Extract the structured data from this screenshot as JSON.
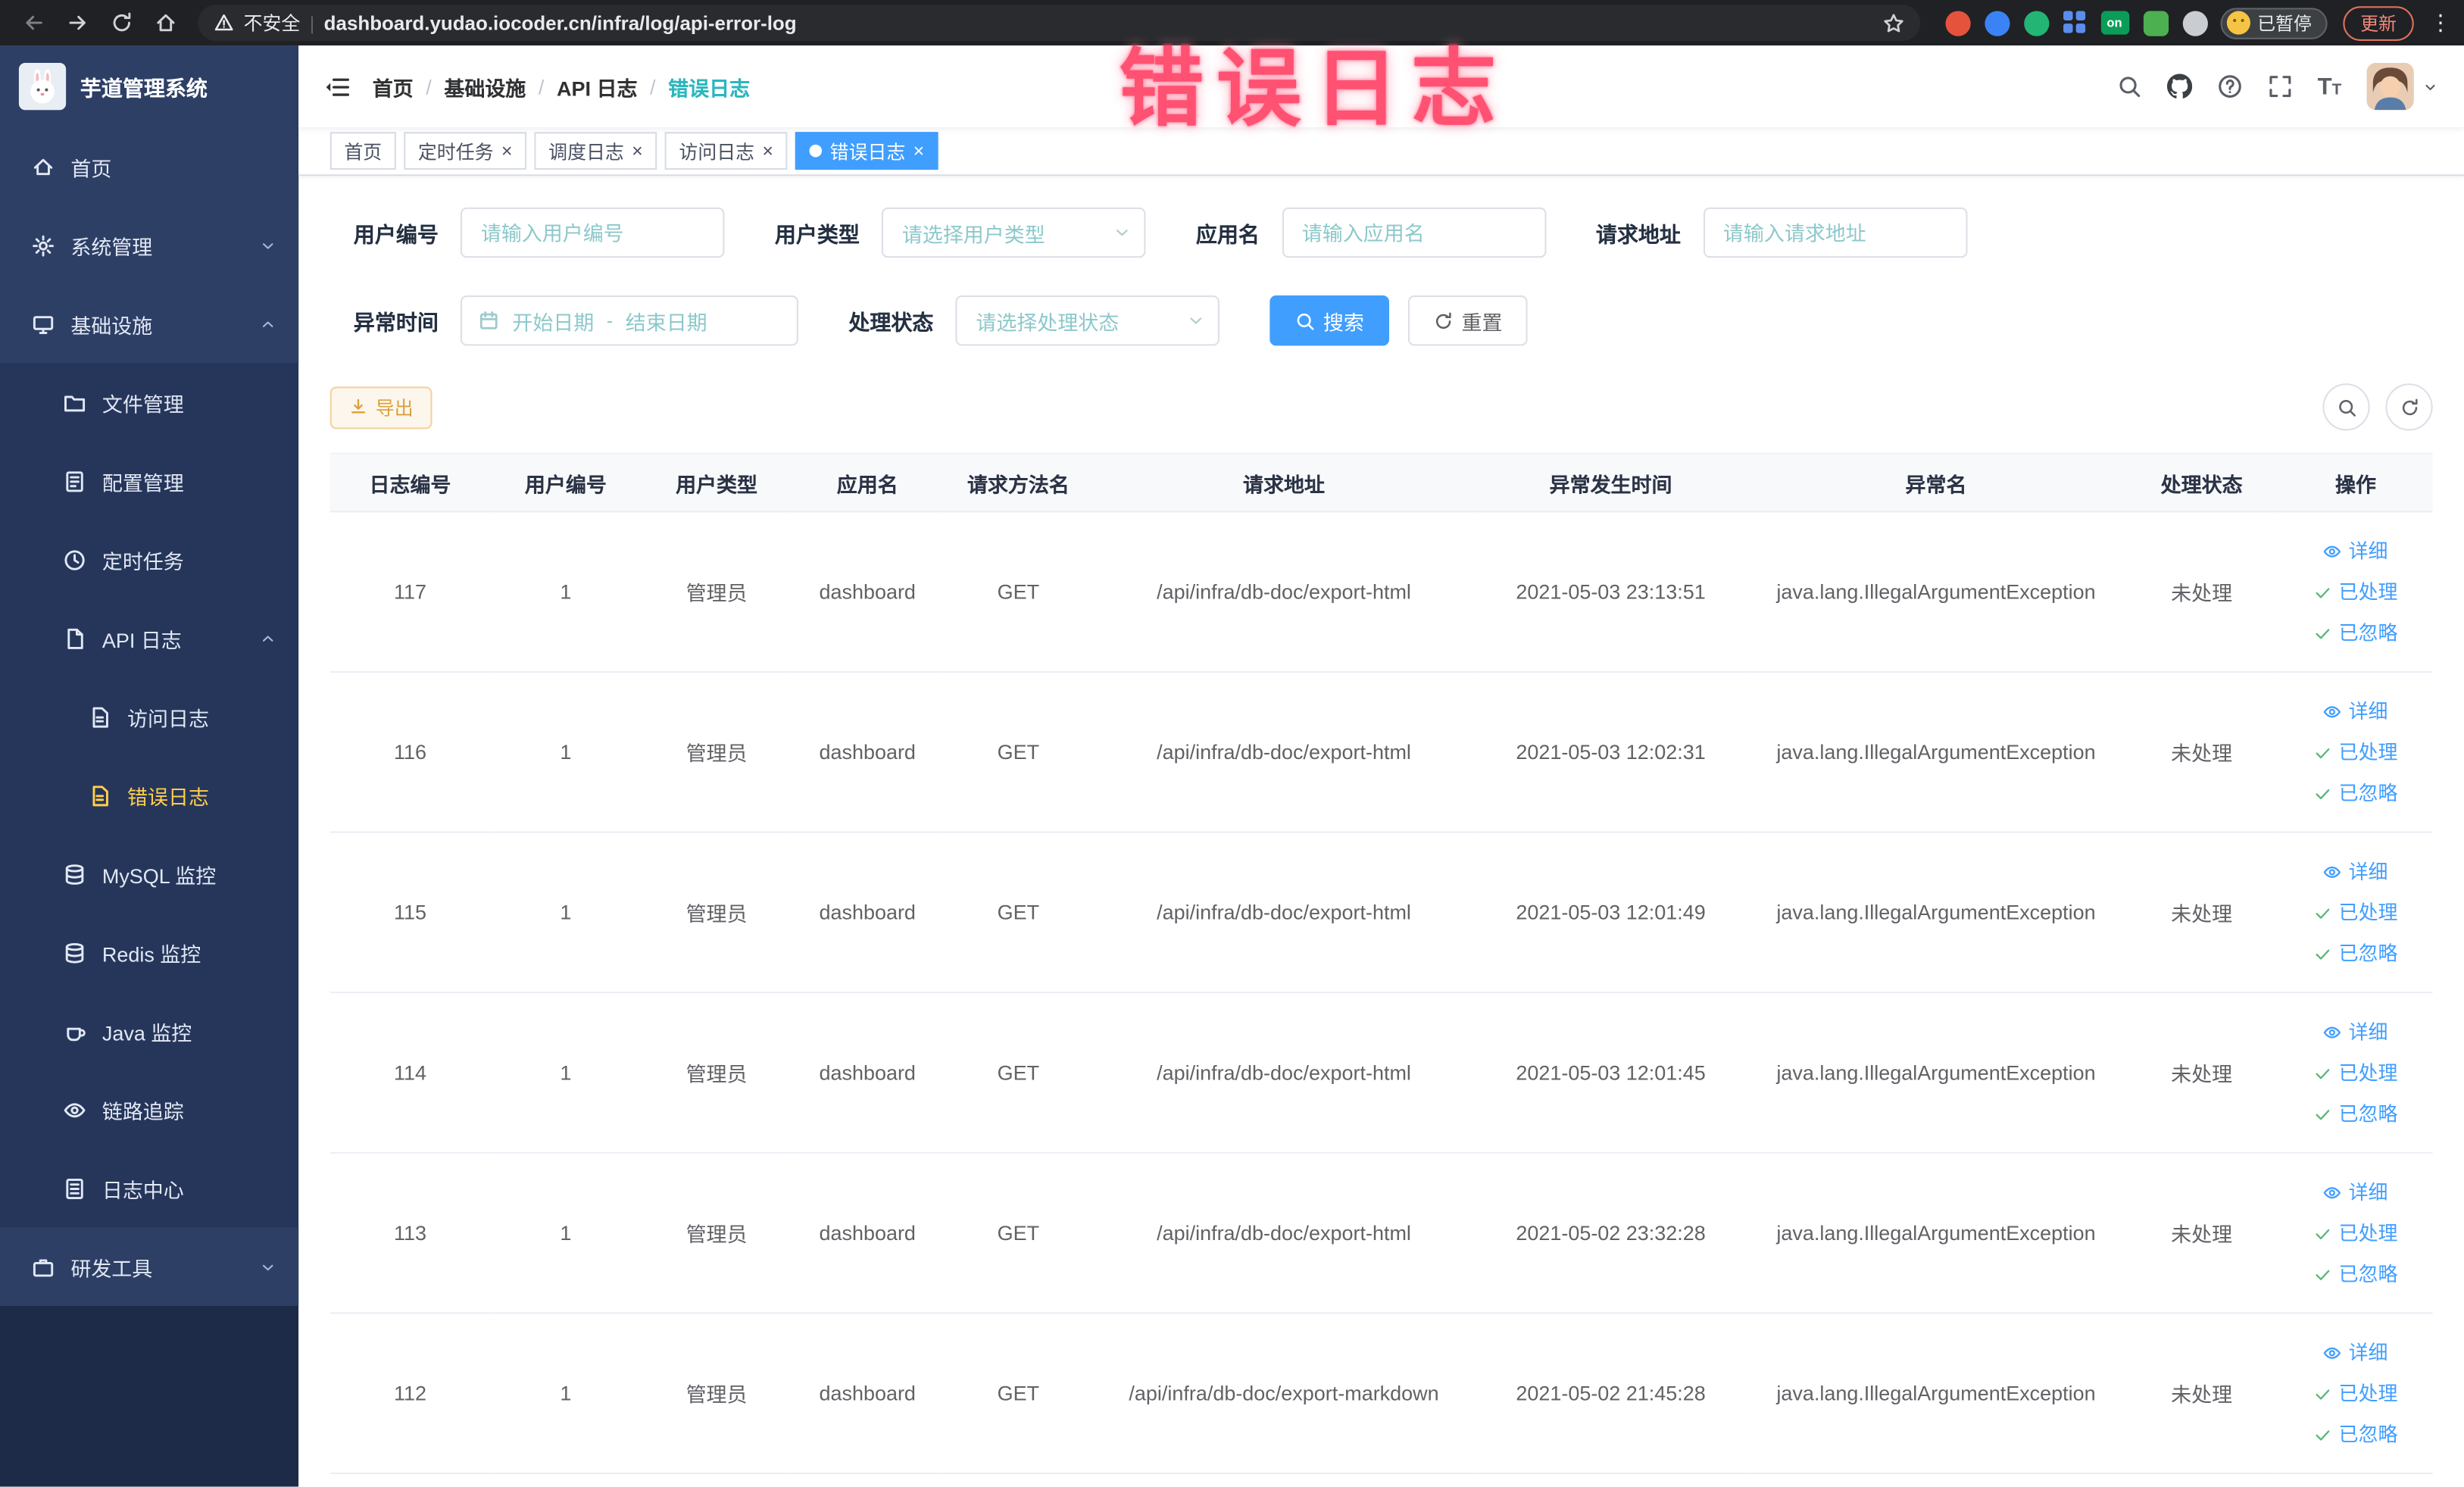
{
  "watermark": "错误日志",
  "browser": {
    "security_label": "不安全",
    "url": "dashboard.yudao.iocoder.cn/infra/log/api-error-log",
    "on_badge": "on",
    "paused_label": "已暂停",
    "update_label": "更新"
  },
  "icons": {
    "close": "×",
    "kebab": "⋮",
    "help": "?",
    "font_big": "T",
    "font_small": "T",
    "omni_separator": "|"
  },
  "sidebar": {
    "logo_title": "芋道管理系统",
    "items": [
      {
        "label": "首页"
      },
      {
        "label": "系统管理"
      },
      {
        "label": "基础设施"
      },
      {
        "label": "文件管理"
      },
      {
        "label": "配置管理"
      },
      {
        "label": "定时任务"
      },
      {
        "label": "API 日志"
      },
      {
        "label": "访问日志"
      },
      {
        "label": "错误日志"
      },
      {
        "label": "MySQL 监控"
      },
      {
        "label": "Redis 监控"
      },
      {
        "label": "Java 监控"
      },
      {
        "label": "链路追踪"
      },
      {
        "label": "日志中心"
      },
      {
        "label": "研发工具"
      }
    ]
  },
  "breadcrumb": [
    "首页",
    "基础设施",
    "API 日志",
    "错误日志"
  ],
  "tabs": [
    {
      "label": "首页"
    },
    {
      "label": "定时任务"
    },
    {
      "label": "调度日志"
    },
    {
      "label": "访问日志"
    },
    {
      "label": "错误日志"
    }
  ],
  "filters": {
    "user_id": {
      "label": "用户编号",
      "placeholder": "请输入用户编号"
    },
    "user_type": {
      "label": "用户类型",
      "placeholder": "请选择用户类型"
    },
    "app_name": {
      "label": "应用名",
      "placeholder": "请输入应用名"
    },
    "request_url": {
      "label": "请求地址",
      "placeholder": "请输入请求地址"
    },
    "exception_time": {
      "label": "异常时间",
      "start_placeholder": "开始日期",
      "separator": "-",
      "end_placeholder": "结束日期"
    },
    "process_status": {
      "label": "处理状态",
      "placeholder": "请选择处理状态"
    },
    "search_label": "搜索",
    "reset_label": "重置"
  },
  "toolbar": {
    "export_label": "导出"
  },
  "table": {
    "headers": [
      "日志编号",
      "用户编号",
      "用户类型",
      "应用名",
      "请求方法名",
      "请求地址",
      "异常发生时间",
      "异常名",
      "处理状态",
      "操作"
    ],
    "actions": [
      "详细",
      "已处理",
      "已忽略"
    ],
    "rows": [
      {
        "id": "117",
        "user_id": "1",
        "user_type": "管理员",
        "app": "dashboard",
        "method": "GET",
        "url": "/api/infra/db-doc/export-html",
        "time": "2021-05-03 23:13:51",
        "exception": "java.lang.IllegalArgumentException",
        "status": "未处理"
      },
      {
        "id": "116",
        "user_id": "1",
        "user_type": "管理员",
        "app": "dashboard",
        "method": "GET",
        "url": "/api/infra/db-doc/export-html",
        "time": "2021-05-03 12:02:31",
        "exception": "java.lang.IllegalArgumentException",
        "status": "未处理"
      },
      {
        "id": "115",
        "user_id": "1",
        "user_type": "管理员",
        "app": "dashboard",
        "method": "GET",
        "url": "/api/infra/db-doc/export-html",
        "time": "2021-05-03 12:01:49",
        "exception": "java.lang.IllegalArgumentException",
        "status": "未处理"
      },
      {
        "id": "114",
        "user_id": "1",
        "user_type": "管理员",
        "app": "dashboard",
        "method": "GET",
        "url": "/api/infra/db-doc/export-html",
        "time": "2021-05-03 12:01:45",
        "exception": "java.lang.IllegalArgumentException",
        "status": "未处理"
      },
      {
        "id": "113",
        "user_id": "1",
        "user_type": "管理员",
        "app": "dashboard",
        "method": "GET",
        "url": "/api/infra/db-doc/export-html",
        "time": "2021-05-02 23:32:28",
        "exception": "java.lang.IllegalArgumentException",
        "status": "未处理"
      },
      {
        "id": "112",
        "user_id": "1",
        "user_type": "管理员",
        "app": "dashboard",
        "method": "GET",
        "url": "/api/infra/db-doc/export-markdown",
        "time": "2021-05-02 21:45:28",
        "exception": "java.lang.IllegalArgumentException",
        "status": "未处理"
      }
    ]
  },
  "colors": {
    "primary": "#409eff",
    "sidebar_active": "#ffd04b",
    "warning": "#e6a23c",
    "watermark": "#ff3f63",
    "breadcrumb_active": "#2bb6bd"
  }
}
